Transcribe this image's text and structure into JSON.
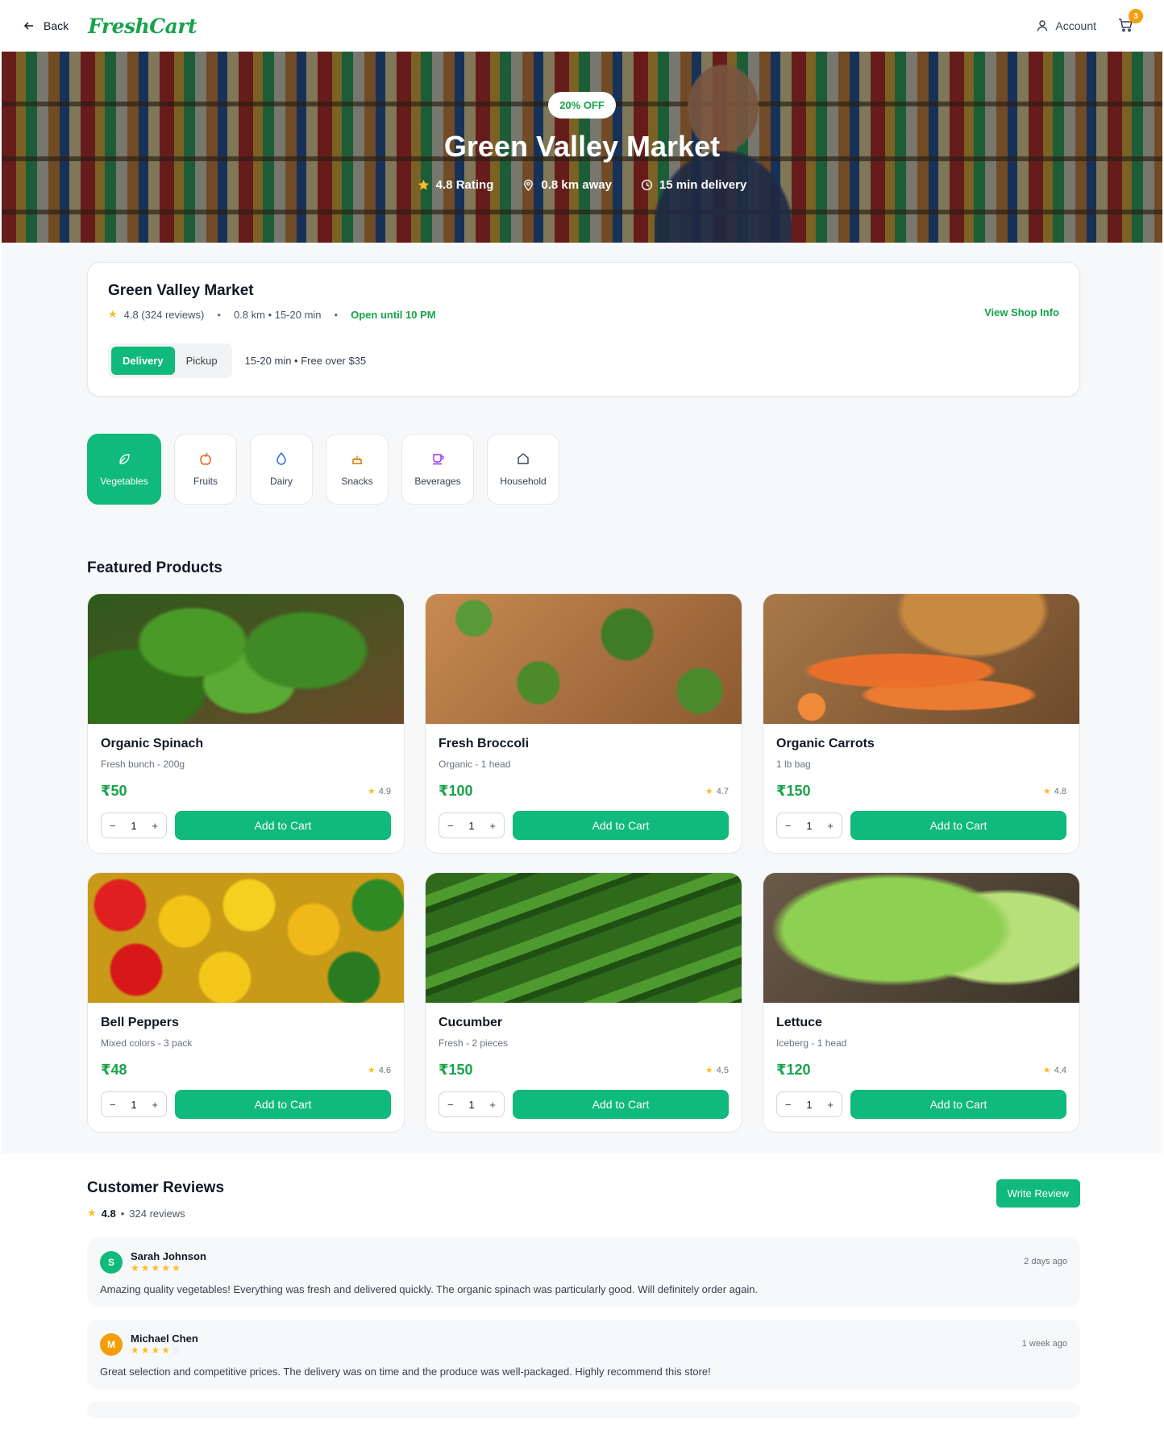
{
  "header": {
    "back_label": "Back",
    "logo": "FreshCart",
    "account_label": "Account",
    "cart_count": "3",
    "brand_color": "#16a34a"
  },
  "hero": {
    "badge": "20% OFF",
    "title": "Green Valley Market",
    "rating": "4.8 Rating",
    "distance": "0.8 km away",
    "delivery": "15 min delivery"
  },
  "shop": {
    "name": "Green Valley Market",
    "rating_text": "4.8 (324 reviews)",
    "distance_time": "0.8 km • 15-20 min",
    "open_status": "Open until 10 PM",
    "view_info": "View Shop Info",
    "modes": [
      "Delivery",
      "Pickup"
    ],
    "active_mode": "Delivery",
    "mode_info": "15-20 min • Free over $35"
  },
  "categories": [
    {
      "label": "Vegetables",
      "icon": "leaf-icon",
      "color": "#ffffff"
    },
    {
      "label": "Fruits",
      "icon": "apple-icon",
      "color": "#ea580c"
    },
    {
      "label": "Dairy",
      "icon": "droplet-icon",
      "color": "#2563eb"
    },
    {
      "label": "Snacks",
      "icon": "cake-icon",
      "color": "#d97706"
    },
    {
      "label": "Beverages",
      "icon": "coffee-icon",
      "color": "#9333ea"
    },
    {
      "label": "Household",
      "icon": "home-icon",
      "color": "#374151"
    }
  ],
  "featured": {
    "title": "Featured Products",
    "add_label": "Add to Cart",
    "products": [
      {
        "name": "Organic Spinach",
        "sub": "Fresh bunch - 200g",
        "price": "₹50",
        "rating": "4.9",
        "qty": "1"
      },
      {
        "name": "Fresh Broccoli",
        "sub": "Organic - 1 head",
        "price": "₹100",
        "rating": "4.7",
        "qty": "1"
      },
      {
        "name": "Organic Carrots",
        "sub": "1 lb bag",
        "price": "₹150",
        "rating": "4.8",
        "qty": "1"
      },
      {
        "name": "Bell Peppers",
        "sub": "Mixed colors - 3 pack",
        "price": "₹48",
        "rating": "4.6",
        "qty": "1"
      },
      {
        "name": "Cucumber",
        "sub": "Fresh - 2 pieces",
        "price": "₹150",
        "rating": "4.5",
        "qty": "1"
      },
      {
        "name": "Lettuce",
        "sub": "Iceberg - 1 head",
        "price": "₹120",
        "rating": "4.4",
        "qty": "1"
      }
    ]
  },
  "reviews": {
    "title": "Customer Reviews",
    "average": "4.8",
    "count": "324 reviews",
    "write_label": "Write Review",
    "items": [
      {
        "initial": "S",
        "name": "Sarah Johnson",
        "stars": 5,
        "time": "2 days ago",
        "color": "#10b97c",
        "text": "Amazing quality vegetables! Everything was fresh and delivered quickly. The organic spinach was particularly good. Will definitely order again."
      },
      {
        "initial": "M",
        "name": "Michael Chen",
        "stars": 4,
        "time": "1 week ago",
        "color": "#f59e0b",
        "text": "Great selection and competitive prices. The delivery was on time and the produce was well-packaged. Highly recommend this store!"
      }
    ]
  }
}
